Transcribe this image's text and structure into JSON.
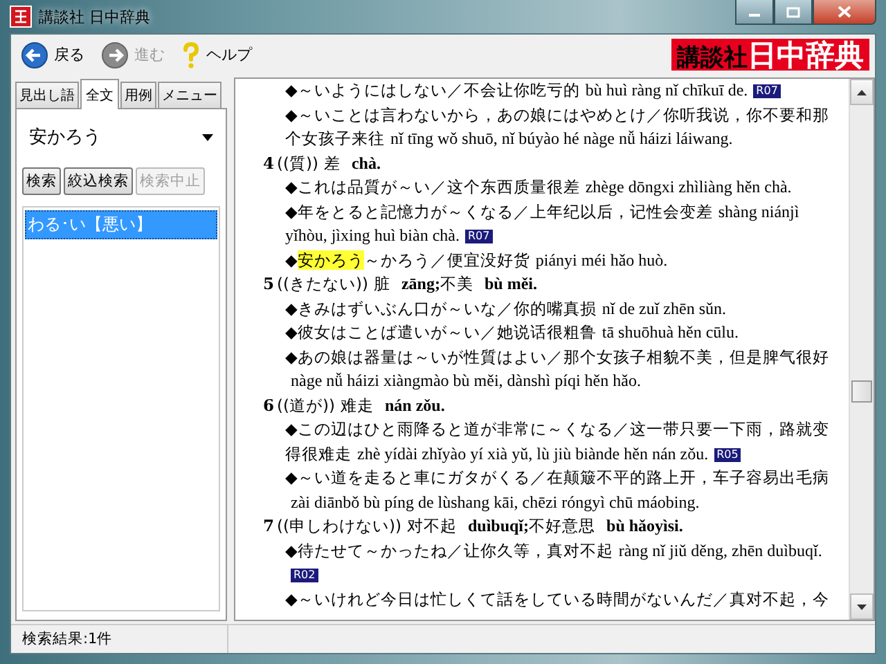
{
  "window": {
    "title": "講談社 日中辞典"
  },
  "toolbar": {
    "buttons": [
      {
        "label": "戻る",
        "kind": "back",
        "disabled": false
      },
      {
        "label": "進む",
        "kind": "forward",
        "disabled": true
      },
      {
        "label": "ヘルプ",
        "kind": "help",
        "disabled": false
      }
    ],
    "logo": {
      "publisher": "講談社",
      "name": "日中辞典"
    }
  },
  "search_panel": {
    "tabs": [
      {
        "label": "見出し語",
        "selected": false
      },
      {
        "label": "全文",
        "selected": true
      },
      {
        "label": "用例",
        "selected": false
      },
      {
        "label": "メニュー",
        "selected": false
      }
    ],
    "query": "安かろう",
    "buttons": [
      {
        "label": "検索",
        "disabled": false
      },
      {
        "label": "絞込検索",
        "disabled": false
      },
      {
        "label": "検索中止",
        "disabled": true
      }
    ],
    "results": [
      {
        "label": "わる･い【悪い】",
        "selected": true
      }
    ]
  },
  "entry": {
    "senses": [
      {
        "examples": [
          {
            "text": "◆～いようにはしない／不会让你吃亏的",
            "pinyin": "bù huì ràng nǐ chīkuī de.",
            "ref": "R07"
          },
          {
            "text": "◆～いことは言わないから，あの娘にはやめとけ／你听我说，你不要和那个女孩子来往",
            "pinyin": "nǐ tīng wǒ shuō, nǐ búyào hé nàge nǚ háizi láiwang."
          }
        ]
      },
      {
        "number": "4",
        "label": "((質))",
        "gloss": [
          {
            "zh": "差",
            "pinyin": "chà."
          }
        ],
        "examples": [
          {
            "text": "◆これは品質が～い／这个东西质量很差",
            "pinyin": "zhège dōngxi zhìliàng hěn chà."
          },
          {
            "text": "◆年をとると記憶力が～くなる／上年纪以后，记性会变差",
            "pinyin": "shàng niánjì yǐhòu, jìxing huì biàn chà.",
            "ref": "R07"
          },
          {
            "lead": "◆",
            "hit": "安かろう",
            "text": "～かろう／便宜没好货",
            "pinyin": "piányi méi hǎo huò."
          }
        ]
      },
      {
        "number": "5",
        "label": "((きたない))",
        "gloss": [
          {
            "zh": "脏",
            "pinyin": "zāng;"
          },
          {
            "zh": "不美",
            "pinyin": "bù měi."
          }
        ],
        "examples": [
          {
            "text": "◆きみはずいぶん口が～いな／你的嘴真损",
            "pinyin": "nǐ de zuǐ zhēn sǔn."
          },
          {
            "text": "◆彼女はことば遣いが～い／她说话很粗鲁",
            "pinyin": "tā shuōhuà hěn cūlu."
          },
          {
            "text": "◆あの娘は器量は～いが性質はよい／那个女孩子相貌不美，但是脾气很好",
            "pinyin": "nàge nǚ háizi xiàngmào bù měi, dànshì píqi hěn hǎo."
          }
        ]
      },
      {
        "number": "6",
        "label": "((道が))",
        "gloss": [
          {
            "zh": "难走",
            "pinyin": "nán zǒu."
          }
        ],
        "examples": [
          {
            "text": "◆この辺はひと雨降ると道が非常に～くなる／这一带只要一下雨，路就变得很难走",
            "pinyin": "zhè yídài zhǐyào yí xià yǔ, lù jiù biànde hěn nán zǒu.",
            "ref": "R05"
          },
          {
            "text": "◆～い道を走ると車にガタがくる／在颠簸不平的路上开，车子容易出毛病",
            "pinyin": "zài diānbǒ bù píng de lùshang kāi, chēzi róngyì chū máobing."
          }
        ]
      },
      {
        "number": "7",
        "label": "((申しわけない))",
        "gloss": [
          {
            "zh": "对不起",
            "pinyin": "duìbuqǐ;"
          },
          {
            "zh": "不好意思",
            "pinyin": "bù hǎoyìsi."
          }
        ],
        "examples": [
          {
            "text": "◆待たせて～かったね／让你久等，真对不起",
            "pinyin": "ràng nǐ jiǔ děng, zhēn duìbuqǐ.",
            "ref": "R02"
          },
          {
            "text": "◆～いけれど今日は忙しくて話をしている時間がないんだ／真对不起，今"
          }
        ]
      }
    ]
  },
  "status_bar": {
    "text": "検索結果:1件"
  }
}
